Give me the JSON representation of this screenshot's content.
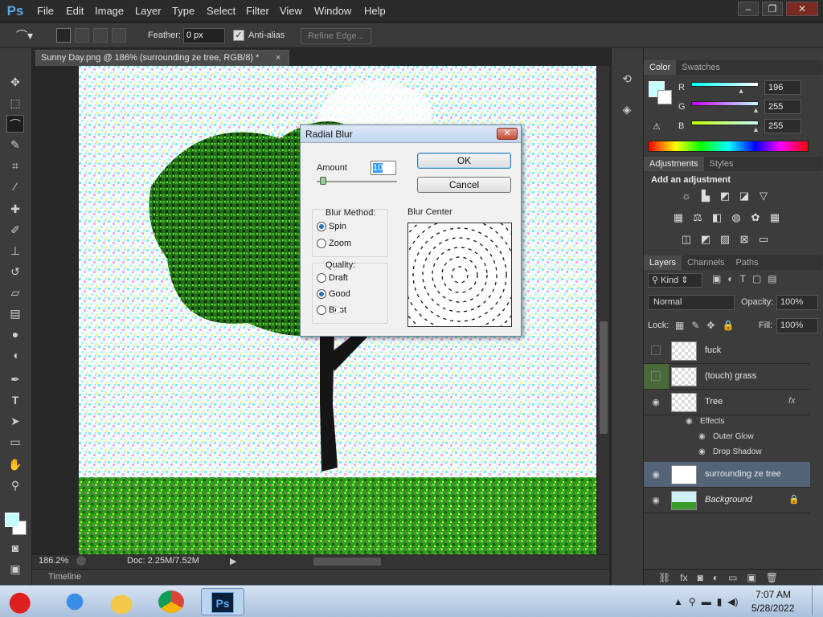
{
  "app": {
    "logo": "Ps"
  },
  "menu": [
    "File",
    "Edit",
    "Image",
    "Layer",
    "Type",
    "Select",
    "Filter",
    "View",
    "Window",
    "Help"
  ],
  "window_controls": [
    "–",
    "❐",
    "✕"
  ],
  "options": {
    "feather_label": "Feather:",
    "feather_value": "0 px",
    "antialias_label": "Anti-alias",
    "antialias_checked": true,
    "refine_label": "Refine Edge..."
  },
  "document": {
    "tab_title": "Sunny Day.png @ 186% (surrounding ze tree, RGB/8) *",
    "close": "×",
    "zoom": "186.2%",
    "doc_size": "Doc: 2.25M/7.52M"
  },
  "timeline": {
    "label": "Timeline"
  },
  "colors": {
    "foreground": "#c4ffff",
    "background": "#ffffff",
    "accent": "#546478"
  },
  "color_panel": {
    "tabs": [
      "Color",
      "Swatches"
    ],
    "channels": [
      {
        "name": "R",
        "value": "196",
        "fill": 0.77
      },
      {
        "name": "G",
        "value": "255",
        "fill": 1.0
      },
      {
        "name": "B",
        "value": "255",
        "fill": 1.0
      }
    ]
  },
  "adjustments": {
    "tabs": [
      "Adjustments",
      "Styles"
    ],
    "heading": "Add an adjustment"
  },
  "layers": {
    "tabs": [
      "Layers",
      "Channels",
      "Paths"
    ],
    "kind": "Kind",
    "blend": "Normal",
    "opacity_label": "Opacity:",
    "opacity": "100%",
    "lock_label": "Lock:",
    "fill_label": "Fill:",
    "fill": "100%",
    "items": [
      {
        "name": "fuck",
        "visible": false
      },
      {
        "name": "(touch) grass",
        "visible": false
      },
      {
        "name": "Tree",
        "visible": true,
        "fx": "fx"
      },
      {
        "name": "surrounding ze tree",
        "visible": true,
        "selected": true
      },
      {
        "name": "Background",
        "visible": true,
        "locked": true
      }
    ],
    "effects_label": "Effects",
    "effects": [
      "Outer Glow",
      "Drop Shadow"
    ]
  },
  "dialog": {
    "title": "Radial Blur",
    "close": "✕",
    "amount_label": "Amount",
    "amount": "10",
    "ok": "OK",
    "cancel": "Cancel",
    "blur_method_label": "Blur Method:",
    "methods": [
      {
        "label": "Spin",
        "selected": true
      },
      {
        "label": "Zoom",
        "selected": false
      }
    ],
    "quality_label": "Quality:",
    "qualities": [
      {
        "label": "Draft",
        "selected": false
      },
      {
        "label": "Good",
        "selected": true
      },
      {
        "label": "Best",
        "selected": false
      }
    ],
    "blur_center_label": "Blur Center"
  },
  "taskbar": {
    "time": "7:07 AM",
    "date": "5/28/2022",
    "apps": [
      "Angry Birds",
      "Internet Explorer",
      "Windows Explorer",
      "Google Chrome",
      "Photoshop"
    ]
  }
}
